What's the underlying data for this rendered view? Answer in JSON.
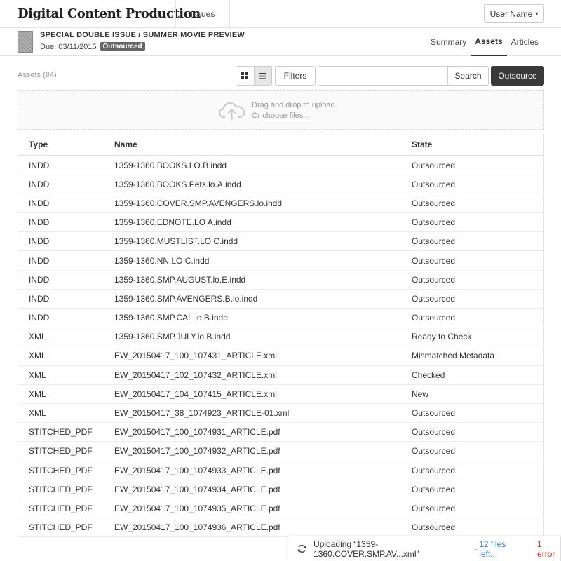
{
  "app": {
    "brand": "Digital Content Production"
  },
  "nav": {
    "issues_label": "Issues"
  },
  "user": {
    "name": "User Name",
    "caret": "▾"
  },
  "issue": {
    "title": "SPECIAL DOUBLE ISSUE / SUMMER MOVIE PREVIEW",
    "due": "Due: 03/11/2015",
    "status_badge": "Outsourced"
  },
  "tabs": [
    {
      "label": "Summary",
      "active": false
    },
    {
      "label": "Assets",
      "active": true
    },
    {
      "label": "Articles",
      "active": false
    }
  ],
  "toolbar": {
    "assets_count": "Assets (94)",
    "filters_label": "Filters",
    "search_placeholder": "",
    "search_label": "Search",
    "outsource_label": "Outsource",
    "view_mode": "list"
  },
  "dropzone": {
    "line1": "Drag and drop to upload.",
    "line2_prefix": "Or ",
    "link_label": "choose files..."
  },
  "table": {
    "columns": [
      "Type",
      "Name",
      "State"
    ],
    "rows": [
      [
        "INDD",
        "1359-1360.BOOKS.LO.B.indd",
        "Outsourced"
      ],
      [
        "INDD",
        "1359-1360.BOOKS.Pets.lo.A.indd",
        "Outsourced"
      ],
      [
        "INDD",
        "1359-1360.COVER.SMP.AVENGERS.lo.indd",
        "Outsourced"
      ],
      [
        "INDD",
        "1359-1360.EDNOTE.LO A.indd",
        "Outsourced"
      ],
      [
        "INDD",
        "1359-1360.MUSTLIST.LO C.indd",
        "Outsourced"
      ],
      [
        "INDD",
        "1359-1360.NN.LO C.indd",
        "Outsourced"
      ],
      [
        "INDD",
        "1359-1360.SMP.AUGUST.lo.E.indd",
        "Outsourced"
      ],
      [
        "INDD",
        "1359-1360.SMP.AVENGERS.B.lo.indd",
        "Outsourced"
      ],
      [
        "INDD",
        "1359-1360.SMP.CAL.lo.B.indd",
        "Outsourced"
      ],
      [
        "XML",
        "1359-1360.SMP.JULY.lo B.indd",
        "Ready to Check"
      ],
      [
        "XML",
        "EW_20150417_100_107431_ARTICLE.xml",
        "Mismatched Metadata"
      ],
      [
        "XML",
        "EW_20150417_102_107432_ARTICLE.xml",
        "Checked"
      ],
      [
        "XML",
        "EW_20150417_104_107415_ARTICLE.xml",
        "New"
      ],
      [
        "XML",
        "EW_20150417_38_1074923_ARTICLE-01.xml",
        "Outsourced"
      ],
      [
        "STITCHED_PDF",
        "EW_20150417_100_1074931_ARTICLE.pdf",
        "Outsourced"
      ],
      [
        "STITCHED_PDF",
        "EW_20150417_100_1074932_ARTICLE.pdf",
        "Outsourced"
      ],
      [
        "STITCHED_PDF",
        "EW_20150417_100_1074933_ARTICLE.pdf",
        "Outsourced"
      ],
      [
        "STITCHED_PDF",
        "EW_20150417_100_1074934_ARTICLE.pdf",
        "Outsourced"
      ],
      [
        "STITCHED_PDF",
        "EW_20150417_100_1074935_ARTICLE.pdf",
        "Outsourced"
      ],
      [
        "STITCHED_PDF",
        "EW_20150417_100_1074936_ARTICLE.pdf",
        "Outsourced"
      ]
    ]
  },
  "upload": {
    "status_text": "Uploading “1359-1360.COVER.SMP.AV...xml”",
    "separator": "-",
    "files_left": "12 files left...",
    "error": "1 error"
  },
  "colors": {
    "outsource_button": "#3a3a3a",
    "badge": "#666666",
    "link_blue": "#3a7bbf",
    "error_red": "#c0392b"
  },
  "icons": {
    "grid_view": "grid-view-icon",
    "list_view": "list-view-icon",
    "upload": "cloud-upload-icon",
    "spinner": "refresh-spinner-icon"
  }
}
